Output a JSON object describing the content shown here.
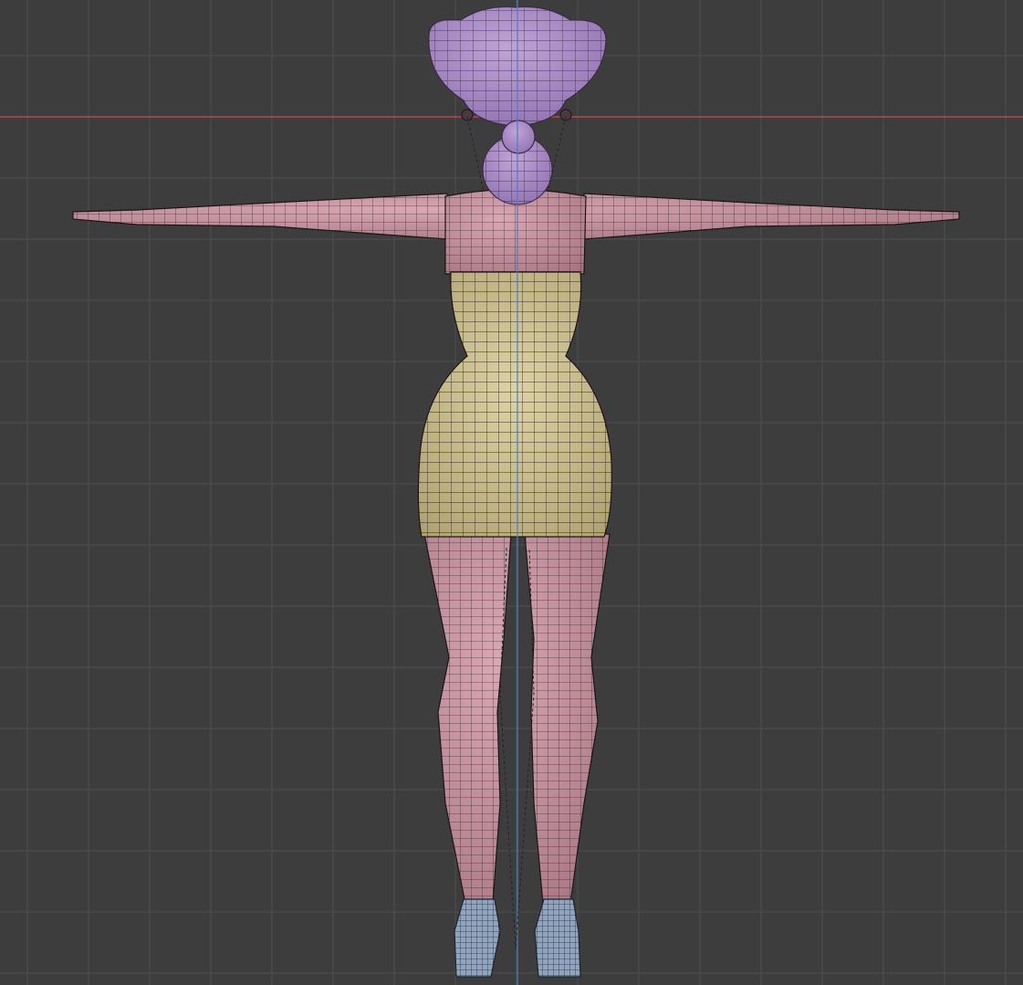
{
  "viewport": {
    "label": "",
    "background": "#3d3d3d",
    "grid_color": "#4f4f4f",
    "x_axis_color": "#b8474f",
    "z_axis_color": "#4d7cc6"
  },
  "model": {
    "skin_color": "#c9939f",
    "dress_color": "#c9bd8c",
    "hair_color": "#a98ac4",
    "shoe_color": "#8ea4bf",
    "wire_color": "#1c1418"
  }
}
